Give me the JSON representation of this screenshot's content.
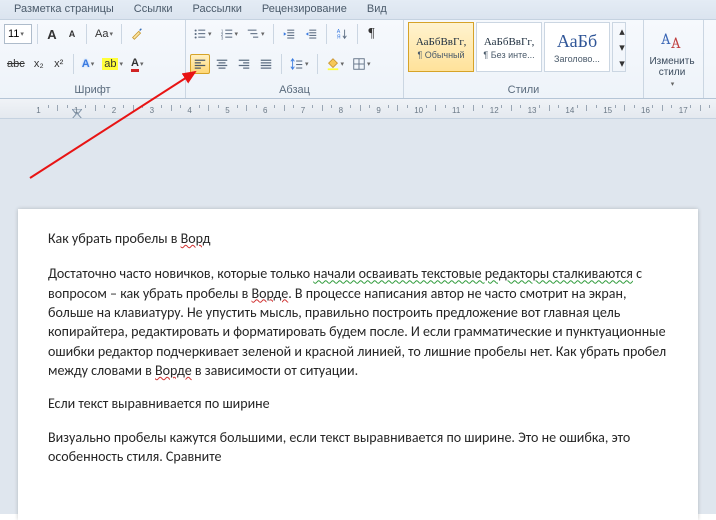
{
  "tabs": {
    "page_layout": "Разметка страницы",
    "links": "Ссылки",
    "mailings": "Рассылки",
    "review": "Рецензирование",
    "view": "Вид"
  },
  "font": {
    "size": "11",
    "grow": "A",
    "shrink": "A",
    "case": "Aa",
    "strike": "abc",
    "sub": "x₂",
    "sup": "x²",
    "effects": "A",
    "highlight": "ab",
    "color": "A"
  },
  "groups": {
    "font": "Шрифт",
    "para": "Абзац",
    "styles": "Стили"
  },
  "styles": {
    "s1": {
      "sample": "АаБбВвГг,",
      "name": "¶ Обычный"
    },
    "s2": {
      "sample": "АаБбВвГг,",
      "name": "¶ Без инте..."
    },
    "s3": {
      "sample": "АаБб",
      "name": "Заголово..."
    },
    "change": "Изменить",
    "change2": "стили"
  },
  "doc": {
    "title_a": "Как убрать пробелы в ",
    "title_b": "Ворд",
    "p1_a": "Достаточно часто новичков, которые только ",
    "p1_b": "начали осваивать текстовые редакторы сталкиваются",
    "p1_c": " с вопросом – как убрать пробелы в ",
    "p1_d": "Ворде",
    "p1_e": ". В процессе написания автор не часто смотрит на экран, больше на клавиатуру. Не упустить мысль, правильно построить предложение вот главная цель копирайтера, редактировать и форматировать будем после. И если грамматические и пунктуационные ошибки редактор подчеркивает зеленой и красной линией, то лишние пробелы нет. Как убрать пробел между словами в ",
    "p1_f": "Ворде",
    "p1_g": " в зависимости от ситуации.",
    "p2": "Если текст выравнивается по ширине",
    "p3": "Визуально пробелы кажутся большими, если текст выравнивается по ширине. Это не ошибка, это особенность стиля. Сравните"
  },
  "ruler": {
    "nums": [
      "1",
      "1",
      "2",
      "3",
      "4",
      "5",
      "6",
      "7",
      "8",
      "9",
      "10",
      "11",
      "12",
      "13",
      "14",
      "15",
      "16",
      "17"
    ]
  }
}
